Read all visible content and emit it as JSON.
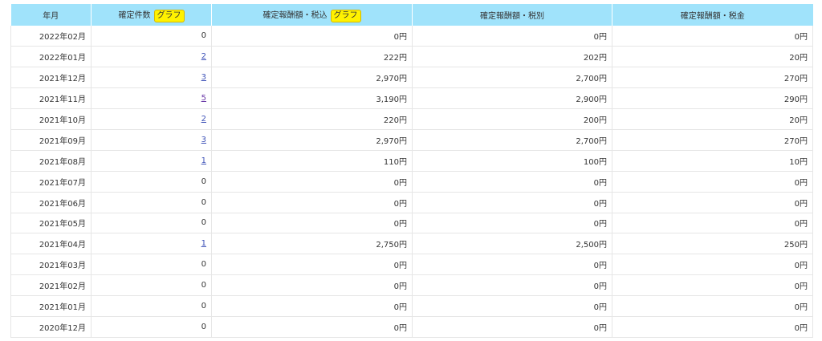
{
  "header": {
    "month": "年月",
    "count": "確定件数",
    "tax_included": "確定報酬額・税込",
    "tax_excluded": "確定報酬額・税別",
    "tax": "確定報酬額・税金",
    "graph_label": "グラフ"
  },
  "rows": [
    {
      "month": "2022年02月",
      "count": "0",
      "count_link": false,
      "tax_included": "0円",
      "tax_excluded": "0円",
      "tax": "0円"
    },
    {
      "month": "2022年01月",
      "count": "2",
      "count_link": true,
      "tax_included": "222円",
      "tax_excluded": "202円",
      "tax": "20円"
    },
    {
      "month": "2021年12月",
      "count": "3",
      "count_link": true,
      "tax_included": "2,970円",
      "tax_excluded": "2,700円",
      "tax": "270円"
    },
    {
      "month": "2021年11月",
      "count": "5",
      "count_link": true,
      "visited": true,
      "tax_included": "3,190円",
      "tax_excluded": "2,900円",
      "tax": "290円"
    },
    {
      "month": "2021年10月",
      "count": "2",
      "count_link": true,
      "tax_included": "220円",
      "tax_excluded": "200円",
      "tax": "20円"
    },
    {
      "month": "2021年09月",
      "count": "3",
      "count_link": true,
      "tax_included": "2,970円",
      "tax_excluded": "2,700円",
      "tax": "270円"
    },
    {
      "month": "2021年08月",
      "count": "1",
      "count_link": true,
      "tax_included": "110円",
      "tax_excluded": "100円",
      "tax": "10円"
    },
    {
      "month": "2021年07月",
      "count": "0",
      "count_link": false,
      "tax_included": "0円",
      "tax_excluded": "0円",
      "tax": "0円"
    },
    {
      "month": "2021年06月",
      "count": "0",
      "count_link": false,
      "tax_included": "0円",
      "tax_excluded": "0円",
      "tax": "0円"
    },
    {
      "month": "2021年05月",
      "count": "0",
      "count_link": false,
      "tax_included": "0円",
      "tax_excluded": "0円",
      "tax": "0円"
    },
    {
      "month": "2021年04月",
      "count": "1",
      "count_link": true,
      "tax_included": "2,750円",
      "tax_excluded": "2,500円",
      "tax": "250円"
    },
    {
      "month": "2021年03月",
      "count": "0",
      "count_link": false,
      "tax_included": "0円",
      "tax_excluded": "0円",
      "tax": "0円"
    },
    {
      "month": "2021年02月",
      "count": "0",
      "count_link": false,
      "tax_included": "0円",
      "tax_excluded": "0円",
      "tax": "0円"
    },
    {
      "month": "2021年01月",
      "count": "0",
      "count_link": false,
      "tax_included": "0円",
      "tax_excluded": "0円",
      "tax": "0円"
    },
    {
      "month": "2020年12月",
      "count": "0",
      "count_link": false,
      "tax_included": "0円",
      "tax_excluded": "0円",
      "tax": "0円"
    }
  ],
  "colors": {
    "header_bg": "#a0e3fb",
    "graph_button_bg": "#fff200",
    "link": "#3f53b8",
    "link_visited": "#6b3aa8",
    "row_border": "#e6e6e6"
  }
}
